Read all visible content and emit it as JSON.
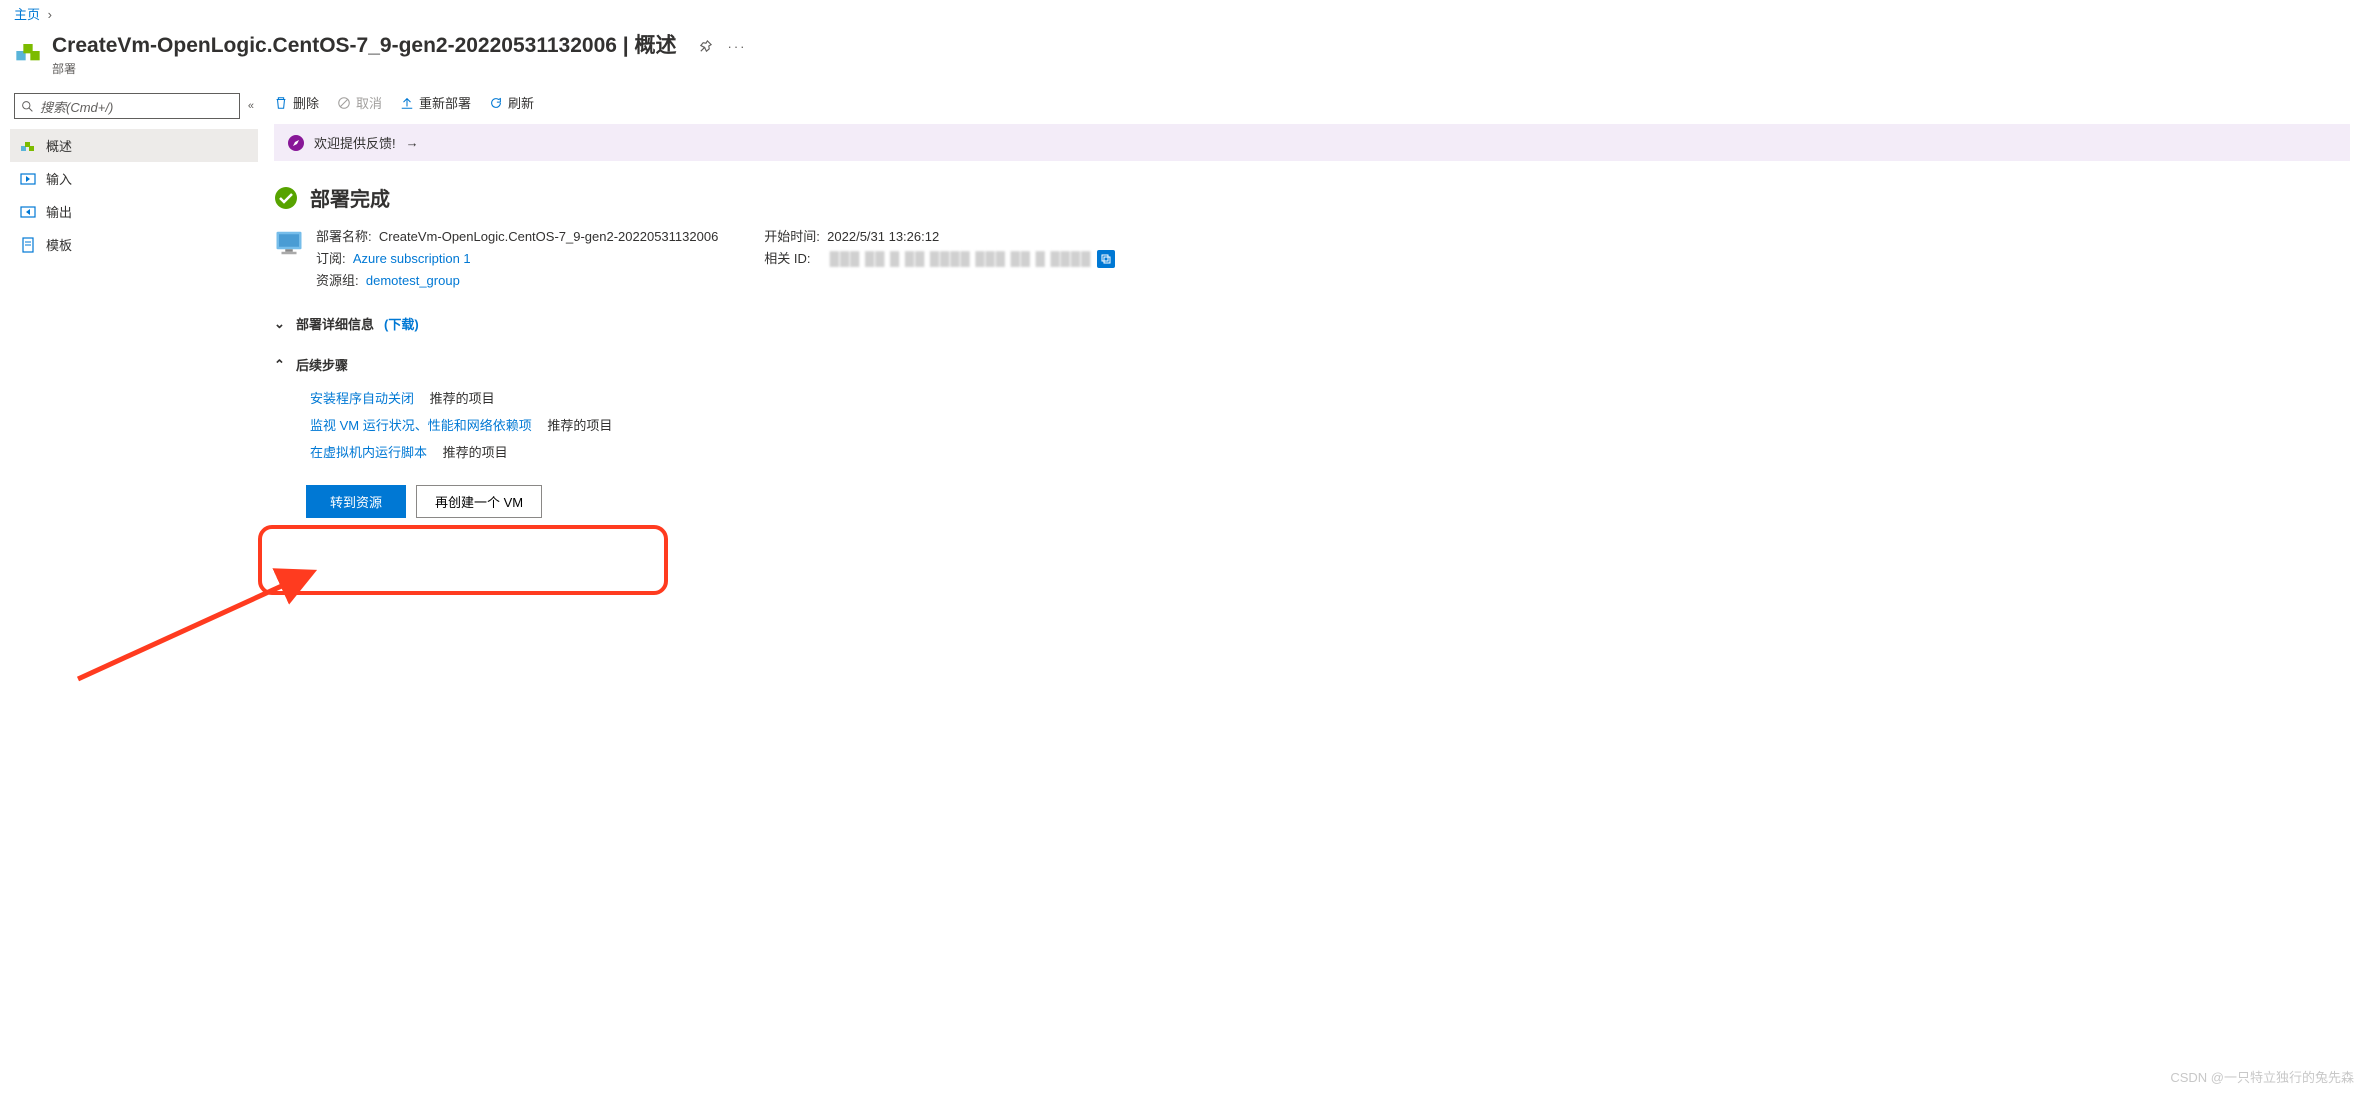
{
  "breadcrumb": {
    "home": "主页"
  },
  "header": {
    "title": "CreateVm-OpenLogic.CentOS-7_9-gen2-20220531132006 | 概述",
    "subtitle": "部署"
  },
  "sidebar": {
    "search_placeholder": "搜索(Cmd+/)",
    "items": [
      {
        "label": "概述",
        "icon": "deployment-icon"
      },
      {
        "label": "输入",
        "icon": "input-icon"
      },
      {
        "label": "输出",
        "icon": "output-icon"
      },
      {
        "label": "模板",
        "icon": "template-icon"
      }
    ]
  },
  "toolbar": {
    "delete": "删除",
    "cancel": "取消",
    "redeploy": "重新部署",
    "refresh": "刷新"
  },
  "feedback": {
    "text": "欢迎提供反馈!"
  },
  "status": {
    "title": "部署完成"
  },
  "details": {
    "name_label": "部署名称:",
    "name_value": "CreateVm-OpenLogic.CentOS-7_9-gen2-20220531132006",
    "sub_label": "订阅:",
    "sub_value": "Azure subscription 1",
    "rg_label": "资源组:",
    "rg_value": "demotest_group",
    "start_label": "开始时间:",
    "start_value": "2022/5/31 13:26:12",
    "corr_label": "相关 ID:"
  },
  "sections": {
    "details_header": "部署详细信息",
    "details_download": "(下载)",
    "next_header": "后续步骤",
    "steps": [
      {
        "link": "安装程序自动关闭",
        "rec": "推荐的项目"
      },
      {
        "link": "监视 VM 运行状况、性能和网络依赖项",
        "rec": "推荐的项目"
      },
      {
        "link": "在虚拟机内运行脚本",
        "rec": "推荐的项目"
      }
    ]
  },
  "buttons": {
    "goto": "转到资源",
    "another": "再创建一个 VM"
  },
  "watermark": "CSDN @一只特立独行的兔先森"
}
